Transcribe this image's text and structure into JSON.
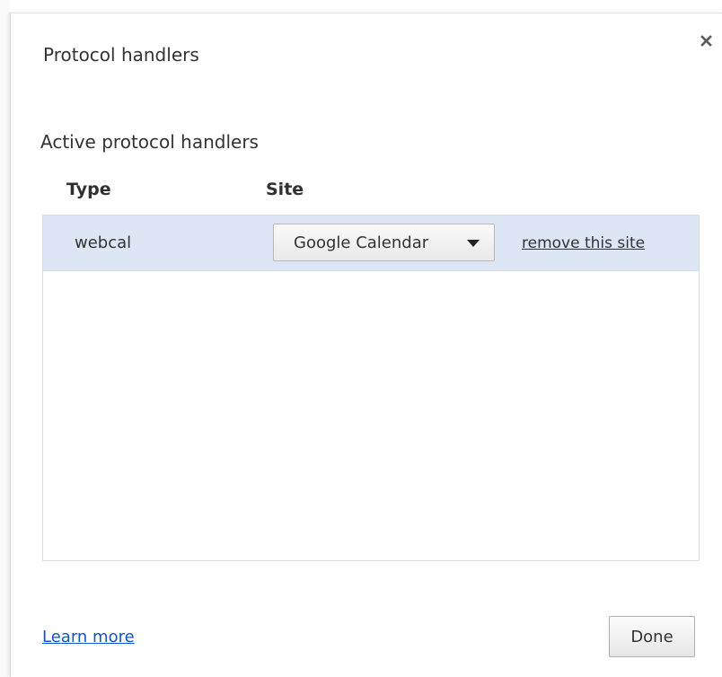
{
  "dialog": {
    "title": "Protocol handlers",
    "close_icon": "close-icon"
  },
  "section": {
    "heading": "Active protocol handlers"
  },
  "table": {
    "columns": [
      "Type",
      "Site"
    ],
    "rows": [
      {
        "type": "webcal",
        "site": "Google Calendar",
        "remove_label": "remove this site",
        "selected": true
      }
    ]
  },
  "footer": {
    "learn_more": "Learn more",
    "done_label": "Done"
  },
  "colors": {
    "selected_row": "#dce6f5",
    "link": "#1155cc",
    "text": "#333333"
  }
}
